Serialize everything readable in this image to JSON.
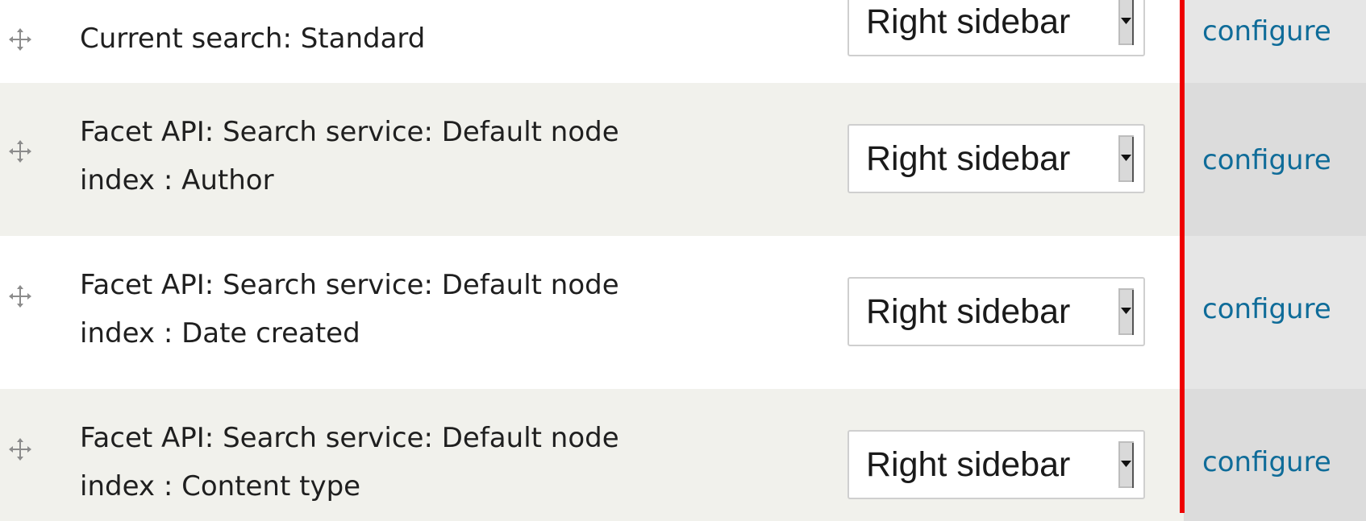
{
  "colors": {
    "row_odd_bg": "#ffffff",
    "row_even_bg": "#f1f1ec",
    "link": "#0f6c99",
    "marker": "#ee0000"
  },
  "icons": {
    "drag_handle": "four-way-arrow-icon",
    "select_arrow": "dropdown-arrow-icon"
  },
  "blocks": [
    {
      "title_line_1": "Current search: Standard",
      "title_line_2": "",
      "region": "Right sidebar",
      "operation": "configure"
    },
    {
      "title_line_1": "Facet API: Search service: Default node",
      "title_line_2": "index : Author",
      "region": "Right sidebar",
      "operation": "configure"
    },
    {
      "title_line_1": "Facet API: Search service: Default node",
      "title_line_2": "index : Date created",
      "region": "Right sidebar",
      "operation": "configure"
    },
    {
      "title_line_1": "Facet API: Search service: Default node",
      "title_line_2": "index : Content type",
      "region": "Right sidebar",
      "operation": "configure"
    }
  ]
}
